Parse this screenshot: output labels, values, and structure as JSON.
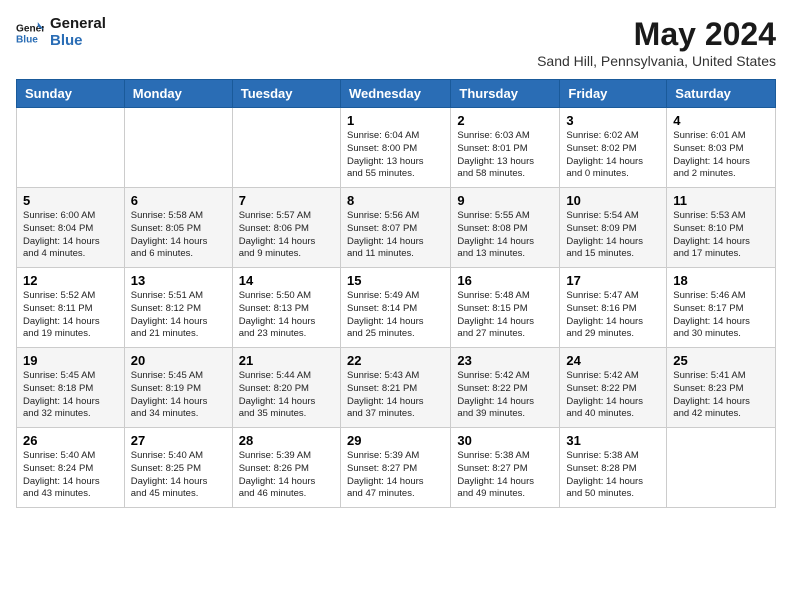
{
  "logo": {
    "line1": "General",
    "line2": "Blue"
  },
  "title": "May 2024",
  "subtitle": "Sand Hill, Pennsylvania, United States",
  "days_of_week": [
    "Sunday",
    "Monday",
    "Tuesday",
    "Wednesday",
    "Thursday",
    "Friday",
    "Saturday"
  ],
  "weeks": [
    [
      {
        "day": "",
        "info": ""
      },
      {
        "day": "",
        "info": ""
      },
      {
        "day": "",
        "info": ""
      },
      {
        "day": "1",
        "info": "Sunrise: 6:04 AM\nSunset: 8:00 PM\nDaylight: 13 hours\nand 55 minutes."
      },
      {
        "day": "2",
        "info": "Sunrise: 6:03 AM\nSunset: 8:01 PM\nDaylight: 13 hours\nand 58 minutes."
      },
      {
        "day": "3",
        "info": "Sunrise: 6:02 AM\nSunset: 8:02 PM\nDaylight: 14 hours\nand 0 minutes."
      },
      {
        "day": "4",
        "info": "Sunrise: 6:01 AM\nSunset: 8:03 PM\nDaylight: 14 hours\nand 2 minutes."
      }
    ],
    [
      {
        "day": "5",
        "info": "Sunrise: 6:00 AM\nSunset: 8:04 PM\nDaylight: 14 hours\nand 4 minutes."
      },
      {
        "day": "6",
        "info": "Sunrise: 5:58 AM\nSunset: 8:05 PM\nDaylight: 14 hours\nand 6 minutes."
      },
      {
        "day": "7",
        "info": "Sunrise: 5:57 AM\nSunset: 8:06 PM\nDaylight: 14 hours\nand 9 minutes."
      },
      {
        "day": "8",
        "info": "Sunrise: 5:56 AM\nSunset: 8:07 PM\nDaylight: 14 hours\nand 11 minutes."
      },
      {
        "day": "9",
        "info": "Sunrise: 5:55 AM\nSunset: 8:08 PM\nDaylight: 14 hours\nand 13 minutes."
      },
      {
        "day": "10",
        "info": "Sunrise: 5:54 AM\nSunset: 8:09 PM\nDaylight: 14 hours\nand 15 minutes."
      },
      {
        "day": "11",
        "info": "Sunrise: 5:53 AM\nSunset: 8:10 PM\nDaylight: 14 hours\nand 17 minutes."
      }
    ],
    [
      {
        "day": "12",
        "info": "Sunrise: 5:52 AM\nSunset: 8:11 PM\nDaylight: 14 hours\nand 19 minutes."
      },
      {
        "day": "13",
        "info": "Sunrise: 5:51 AM\nSunset: 8:12 PM\nDaylight: 14 hours\nand 21 minutes."
      },
      {
        "day": "14",
        "info": "Sunrise: 5:50 AM\nSunset: 8:13 PM\nDaylight: 14 hours\nand 23 minutes."
      },
      {
        "day": "15",
        "info": "Sunrise: 5:49 AM\nSunset: 8:14 PM\nDaylight: 14 hours\nand 25 minutes."
      },
      {
        "day": "16",
        "info": "Sunrise: 5:48 AM\nSunset: 8:15 PM\nDaylight: 14 hours\nand 27 minutes."
      },
      {
        "day": "17",
        "info": "Sunrise: 5:47 AM\nSunset: 8:16 PM\nDaylight: 14 hours\nand 29 minutes."
      },
      {
        "day": "18",
        "info": "Sunrise: 5:46 AM\nSunset: 8:17 PM\nDaylight: 14 hours\nand 30 minutes."
      }
    ],
    [
      {
        "day": "19",
        "info": "Sunrise: 5:45 AM\nSunset: 8:18 PM\nDaylight: 14 hours\nand 32 minutes."
      },
      {
        "day": "20",
        "info": "Sunrise: 5:45 AM\nSunset: 8:19 PM\nDaylight: 14 hours\nand 34 minutes."
      },
      {
        "day": "21",
        "info": "Sunrise: 5:44 AM\nSunset: 8:20 PM\nDaylight: 14 hours\nand 35 minutes."
      },
      {
        "day": "22",
        "info": "Sunrise: 5:43 AM\nSunset: 8:21 PM\nDaylight: 14 hours\nand 37 minutes."
      },
      {
        "day": "23",
        "info": "Sunrise: 5:42 AM\nSunset: 8:22 PM\nDaylight: 14 hours\nand 39 minutes."
      },
      {
        "day": "24",
        "info": "Sunrise: 5:42 AM\nSunset: 8:22 PM\nDaylight: 14 hours\nand 40 minutes."
      },
      {
        "day": "25",
        "info": "Sunrise: 5:41 AM\nSunset: 8:23 PM\nDaylight: 14 hours\nand 42 minutes."
      }
    ],
    [
      {
        "day": "26",
        "info": "Sunrise: 5:40 AM\nSunset: 8:24 PM\nDaylight: 14 hours\nand 43 minutes."
      },
      {
        "day": "27",
        "info": "Sunrise: 5:40 AM\nSunset: 8:25 PM\nDaylight: 14 hours\nand 45 minutes."
      },
      {
        "day": "28",
        "info": "Sunrise: 5:39 AM\nSunset: 8:26 PM\nDaylight: 14 hours\nand 46 minutes."
      },
      {
        "day": "29",
        "info": "Sunrise: 5:39 AM\nSunset: 8:27 PM\nDaylight: 14 hours\nand 47 minutes."
      },
      {
        "day": "30",
        "info": "Sunrise: 5:38 AM\nSunset: 8:27 PM\nDaylight: 14 hours\nand 49 minutes."
      },
      {
        "day": "31",
        "info": "Sunrise: 5:38 AM\nSunset: 8:28 PM\nDaylight: 14 hours\nand 50 minutes."
      },
      {
        "day": "",
        "info": ""
      }
    ]
  ]
}
